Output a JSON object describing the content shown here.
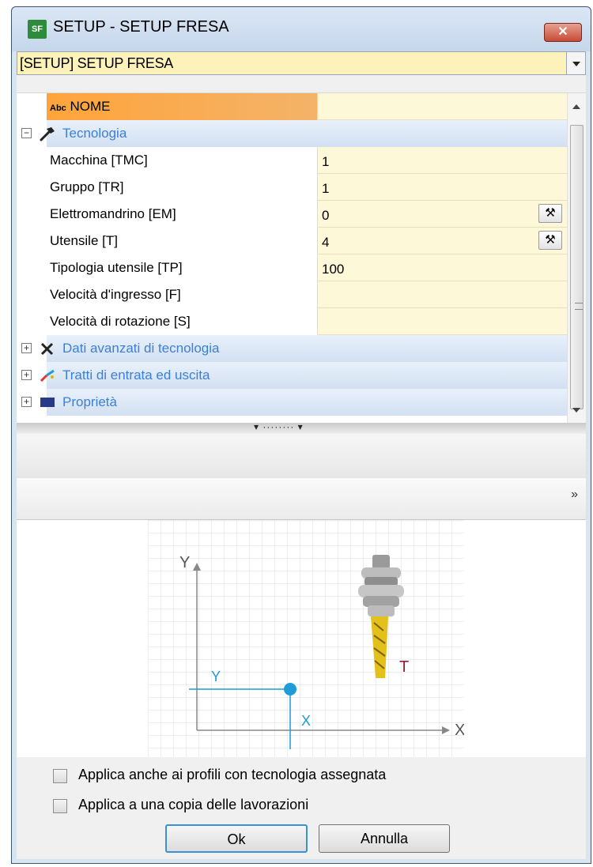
{
  "window": {
    "title": "SETUP - SETUP FRESA",
    "icon_text": "⚓",
    "close_glyph": "✕"
  },
  "selector": {
    "value": "[SETUP] SETUP FRESA"
  },
  "grid": {
    "header_label": "NOME",
    "header_prefix": "Abc",
    "header_value": "",
    "category_tecnologia": "Tecnologia",
    "rows": [
      {
        "label": "Macchina [TMC]",
        "value": "1"
      },
      {
        "label": "Gruppo [TR]",
        "value": "1"
      },
      {
        "label": "Elettromandrino [EM]",
        "value": "0"
      },
      {
        "label": "Utensile [T]",
        "value": "4"
      },
      {
        "label": "Tipologia utensile [TP]",
        "value": "100"
      },
      {
        "label": "Velocità d'ingresso [F]",
        "value": ""
      },
      {
        "label": "Velocità di rotazione [S]",
        "value": ""
      }
    ],
    "category_avanzati": "Dati avanzati di tecnologia",
    "category_tratti": "Tratti di entrata ed uscita",
    "category_proprieta": "Proprietà",
    "tool_button_icon": "tools-icon"
  },
  "preview": {
    "axis_y_top": "Y",
    "axis_x_right": "X",
    "marker_y": "Y",
    "marker_x": "X",
    "tool_label": "T",
    "accent": "#1f9bd7",
    "tool_label_color": "#9b1b30"
  },
  "options": {
    "apply_assigned": "Applica anche ai profili con tecnologia assegnata",
    "apply_copy": "Applica a una copia delle lavorazioni"
  },
  "buttons": {
    "ok": "Ok",
    "cancel": "Annulla"
  }
}
